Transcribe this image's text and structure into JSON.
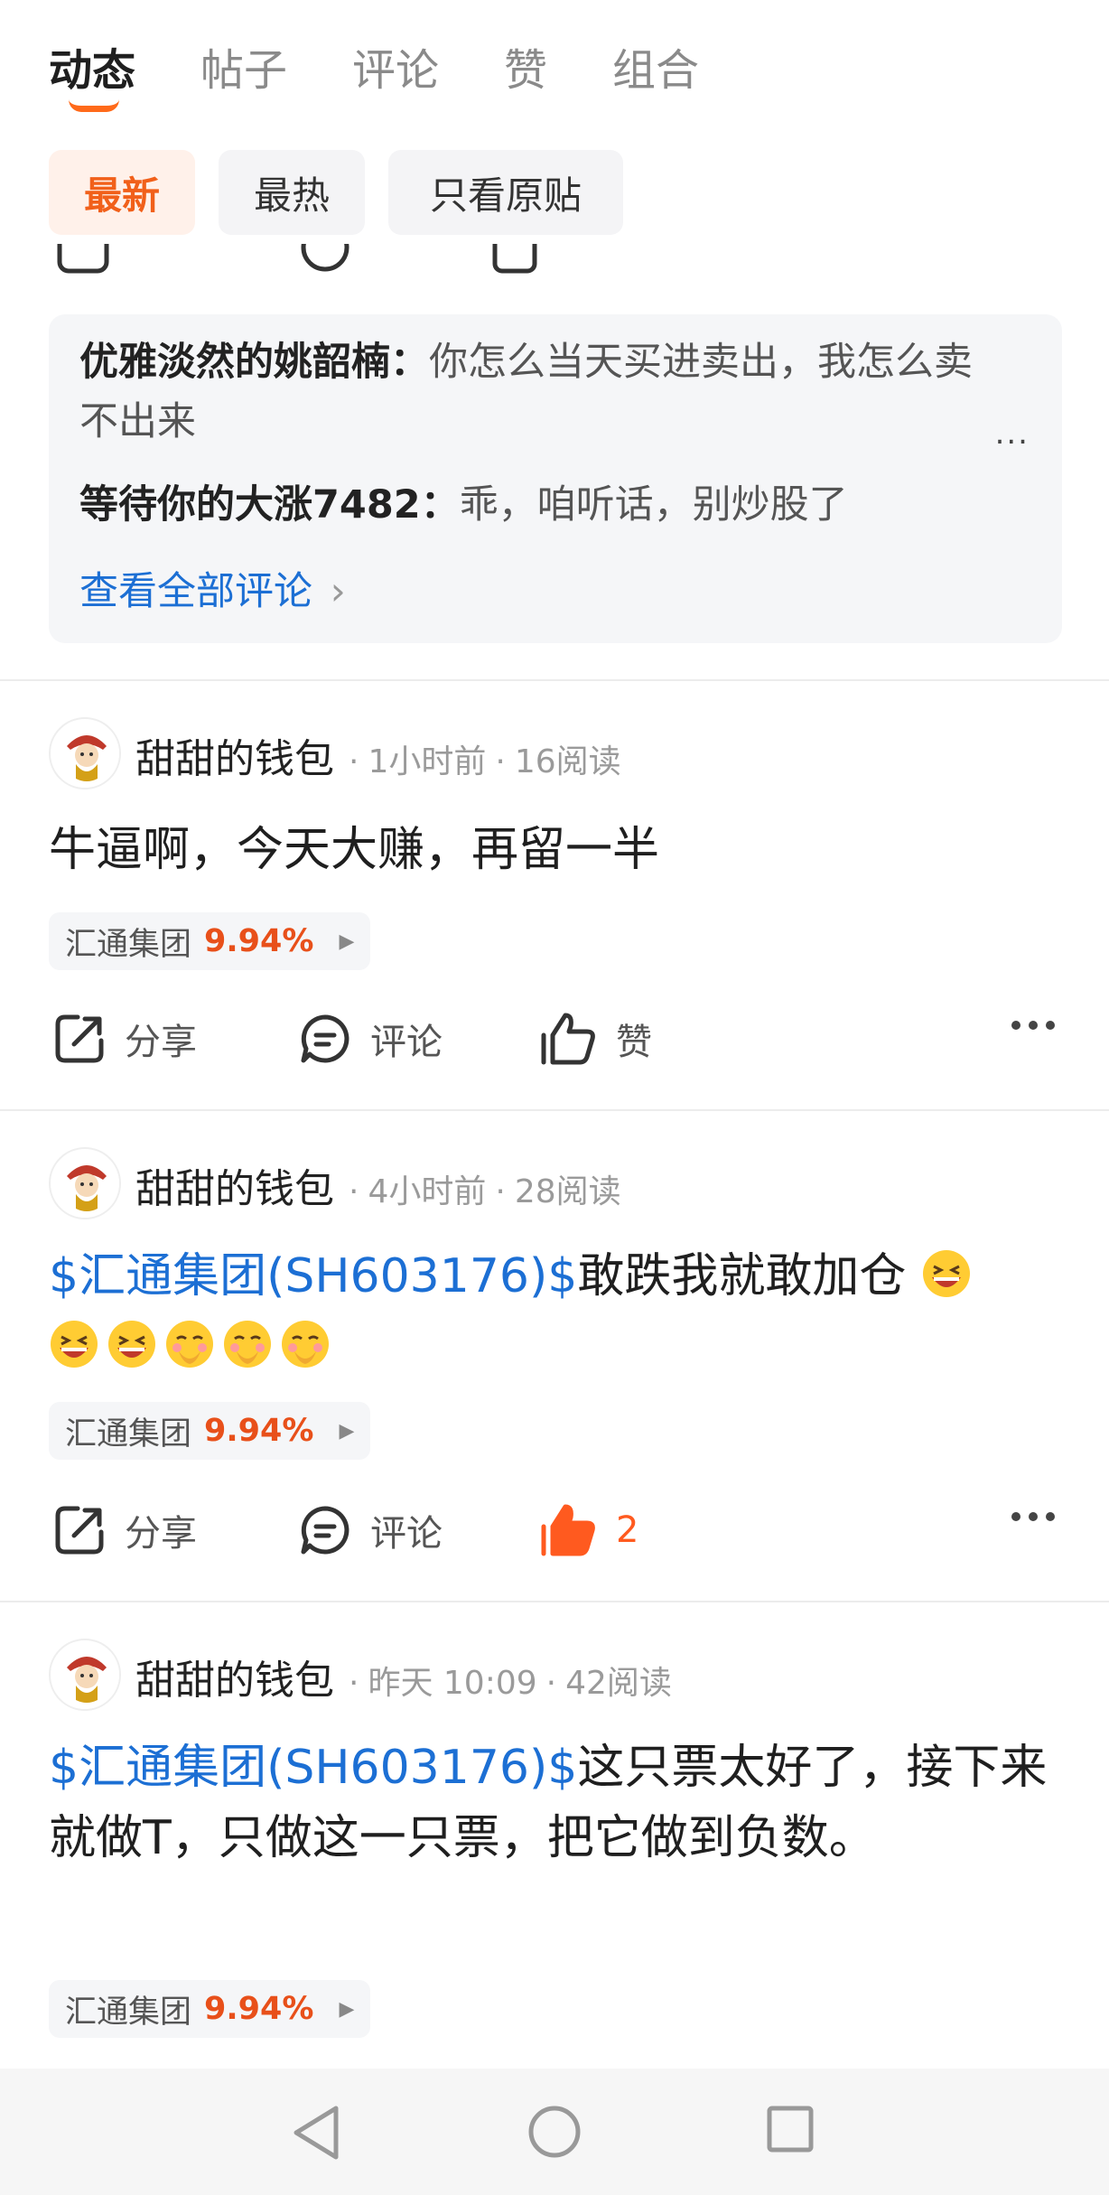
{
  "tabs": [
    {
      "label": "动态",
      "active": true
    },
    {
      "label": "帖子",
      "active": false
    },
    {
      "label": "评论",
      "active": false
    },
    {
      "label": "赞",
      "active": false
    },
    {
      "label": "组合",
      "active": false
    }
  ],
  "filters": [
    {
      "label": "最新",
      "active": true
    },
    {
      "label": "最热",
      "active": false
    },
    {
      "label": "只看原贴",
      "active": false
    }
  ],
  "comments": [
    {
      "author": "优雅淡然的姚韶楠",
      "sep": "：",
      "text": "你怎么当天买进卖出，我怎么卖不出来"
    },
    {
      "author": "等待你的大涨7482",
      "sep": "：",
      "text": "乖，咱听话，别炒股了"
    }
  ],
  "comment_more": "...",
  "view_all_comments": "查看全部评论",
  "view_all_chevron": "›",
  "posts": [
    {
      "author": "甜甜的钱包",
      "time": "1小时前",
      "reads": "16阅读",
      "stock_link": "",
      "text": "牛逼啊，今天大赚，再留一半",
      "tag_name": "汇通集团",
      "tag_pct": "9.94%",
      "share": "分享",
      "comment": "评论",
      "like": "赞",
      "liked": false
    },
    {
      "author": "甜甜的钱包",
      "time": "4小时前",
      "reads": "28阅读",
      "stock_link": "$汇通集团(SH603176)$",
      "text": "敢跌我就敢加仓",
      "emojis": [
        "grin-squint-emoji",
        "grin-squint-emoji",
        "grin-squint-emoji",
        "hand-over-mouth-emoji",
        "hand-over-mouth-emoji",
        "hand-over-mouth-emoji"
      ],
      "tag_name": "汇通集团",
      "tag_pct": "9.94%",
      "share": "分享",
      "comment": "评论",
      "like": "2",
      "liked": true
    },
    {
      "author": "甜甜的钱包",
      "time": "昨天 10:09",
      "reads": "42阅读",
      "stock_link": "$汇通集团(SH603176)$",
      "text": "这只票太好了，接下来就做T，只做这一只票，把它做到负数。",
      "tag_name": "汇通集团",
      "tag_pct": "9.94%"
    }
  ],
  "dot_sep": "·",
  "tag_arrow": "▶",
  "colors": {
    "accent": "#f1601a",
    "link": "#1c6fd4",
    "rise": "#e8501a"
  },
  "navbar": [
    "back-icon",
    "home-icon",
    "recents-icon"
  ]
}
